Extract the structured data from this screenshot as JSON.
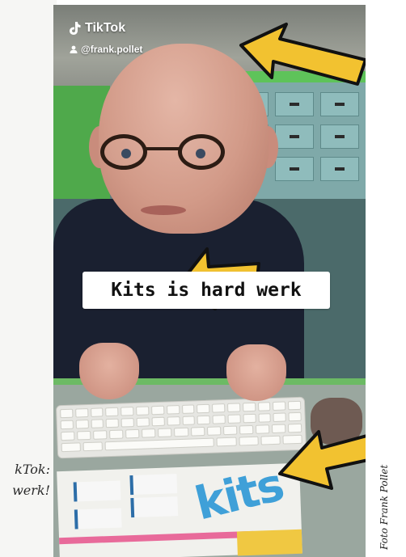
{
  "tiktok": {
    "brand": "TikTok",
    "username": "@frank.pollet",
    "logo_icon": "tiktok-note-icon",
    "user_icon": "person-icon"
  },
  "video": {
    "caption": "Kits is hard werk",
    "brochure_logo": "kits"
  },
  "page": {
    "side_caption_line1": "kTok:",
    "side_caption_line2": "werk!",
    "photo_credit": "Foto  Frank Pollet"
  },
  "colors": {
    "arrow_yellow": "#f2c230",
    "caption_bg": "#ffffff",
    "wall_green": "#5ec35a"
  }
}
